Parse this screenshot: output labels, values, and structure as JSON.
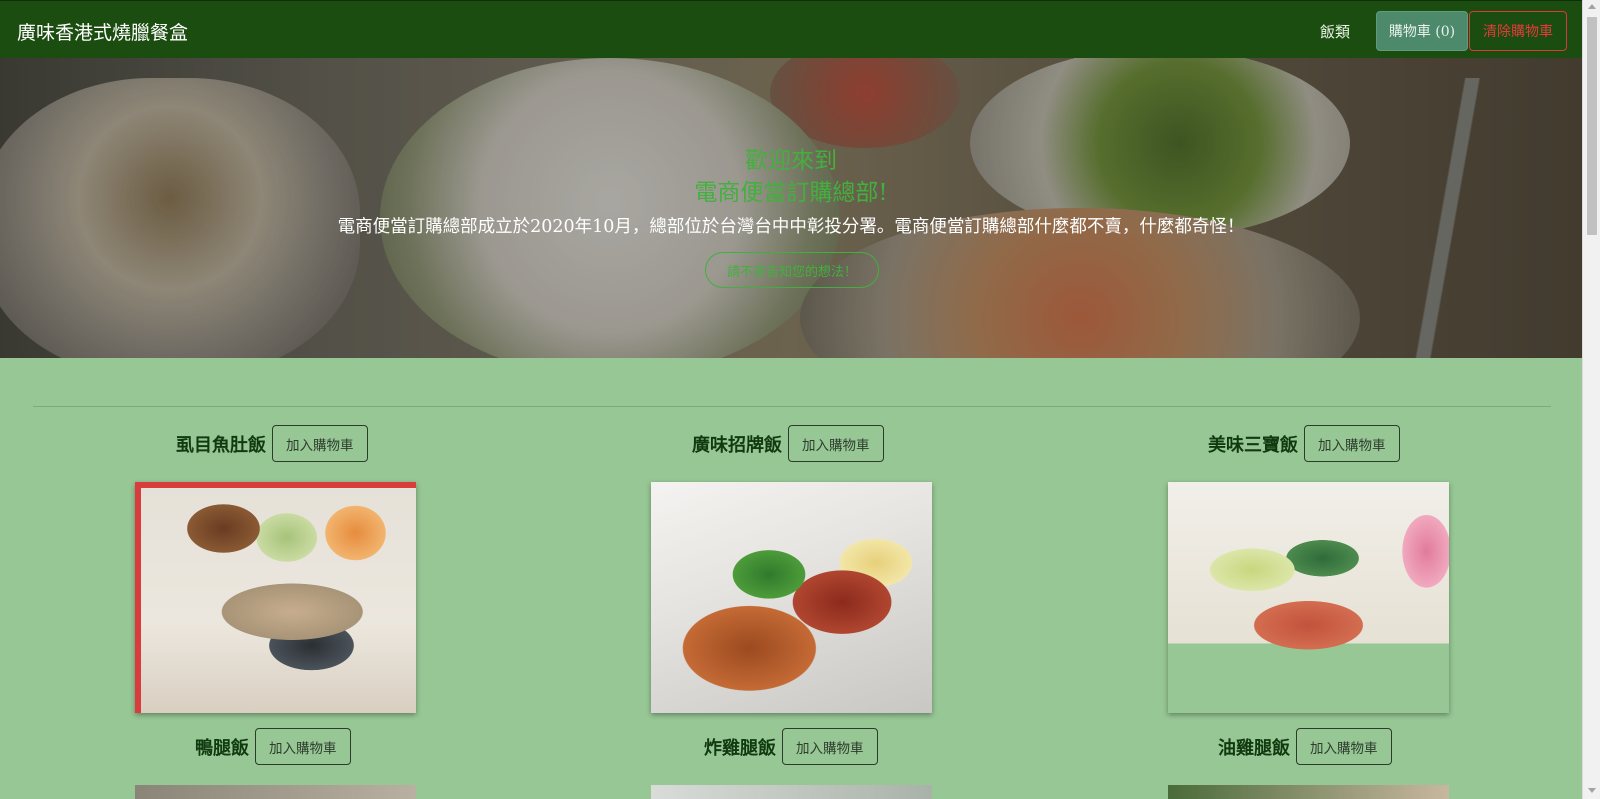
{
  "navbar": {
    "brand": "廣味香港式燒臘餐盒",
    "menu_link": "飯類",
    "cart_button": "購物車 (0)",
    "clear_cart_button": "清除購物車"
  },
  "hero": {
    "title_line1": "歡迎來到",
    "title_line2": "電商便當訂購總部!",
    "description": "電商便當訂購總部成立於2020年10月，總部位於台灣台中中彰投分署。電商便當訂購總部什麼都不賣，什麼都奇怪！",
    "feedback_button": "請不吝告知您的想法！"
  },
  "products": [
    {
      "name": "虱目魚肚飯",
      "add_label": "加入購物車"
    },
    {
      "name": "廣味招牌飯",
      "add_label": "加入購物車"
    },
    {
      "name": "美味三寶飯",
      "add_label": "加入購物車"
    },
    {
      "name": "鴨腿飯",
      "add_label": "加入購物車"
    },
    {
      "name": "炸雞腿飯",
      "add_label": "加入購物車"
    },
    {
      "name": "油雞腿飯",
      "add_label": "加入購物車"
    }
  ],
  "colors": {
    "navbar_bg": "#1b4d10",
    "page_bg": "#97c795",
    "accent_green": "#43b03e",
    "danger_red": "#e23b3b",
    "cart_button_bg": "#4d8a6c"
  }
}
